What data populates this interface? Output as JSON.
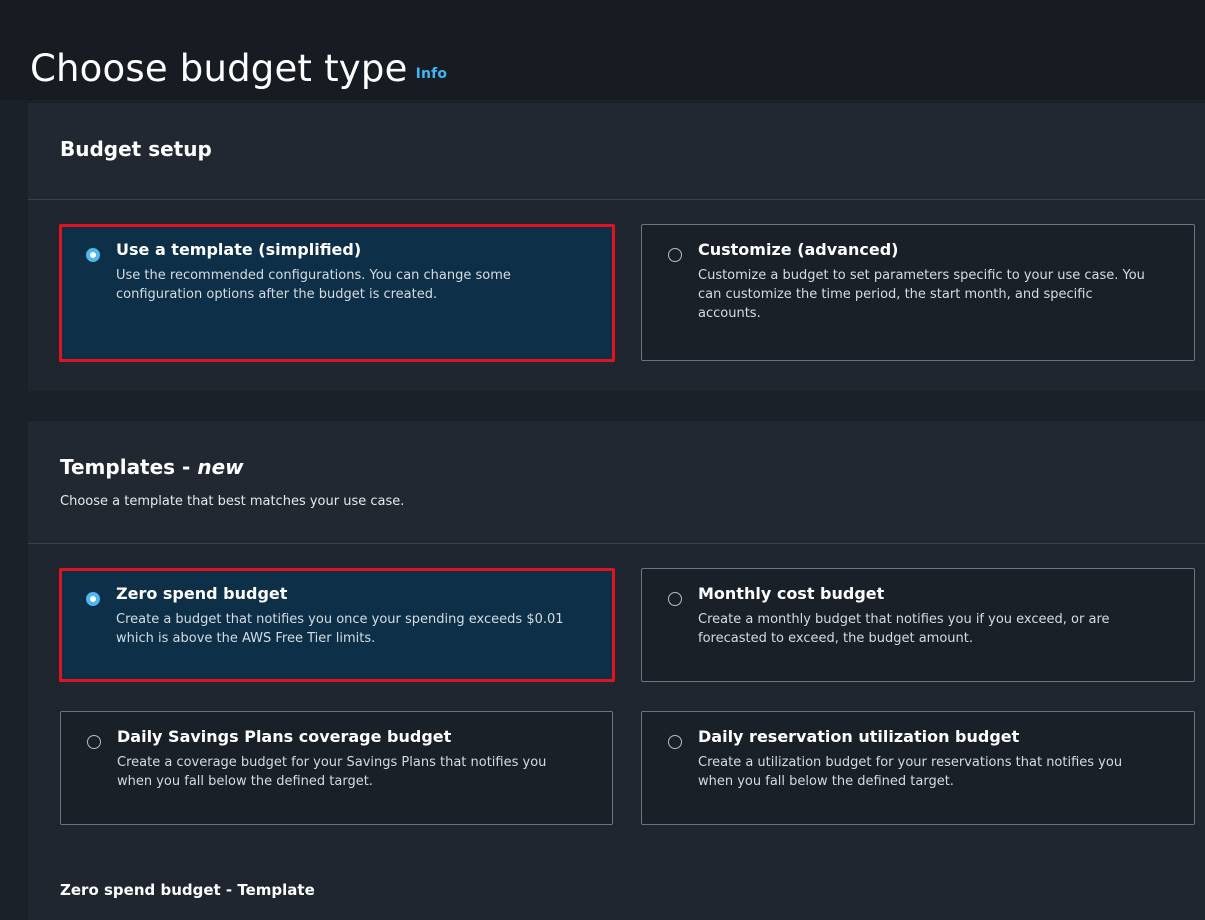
{
  "page": {
    "title": "Choose budget type",
    "info_link": "Info"
  },
  "budget_setup": {
    "title": "Budget setup",
    "options": [
      {
        "label": "Use a template (simplified)",
        "description": "Use the recommended configurations. You can change some configuration options after the budget is created.",
        "selected": true
      },
      {
        "label": "Customize (advanced)",
        "description": "Customize a budget to set parameters specific to your use case. You can customize the time period, the start month, and specific accounts.",
        "selected": false
      }
    ]
  },
  "templates": {
    "title": "Templates - ",
    "title_badge": "new",
    "description": "Choose a template that best matches your use case.",
    "options": [
      {
        "label": "Zero spend budget",
        "description": "Create a budget that notifies you once your spending exceeds $0.01 which is above the AWS Free Tier limits.",
        "selected": true
      },
      {
        "label": "Monthly cost budget",
        "description": "Create a monthly budget that notifies you if you exceed, or are forecasted to exceed, the budget amount.",
        "selected": false
      },
      {
        "label": "Daily Savings Plans coverage budget",
        "description": "Create a coverage budget for your Savings Plans that notifies you when you fall below the defined target.",
        "selected": false
      },
      {
        "label": "Daily reservation utilization budget",
        "description": "Create a utilization budget for your reservations that notifies you when you fall below the defined target.",
        "selected": false
      }
    ],
    "selected_template_heading": "Zero spend budget - Template"
  },
  "colors": {
    "background": "#1b2129",
    "selected_tile": "#0d3048",
    "highlight_border": "#e0141e",
    "radio_accent": "#4fb6ee",
    "link": "#42b4f2"
  }
}
